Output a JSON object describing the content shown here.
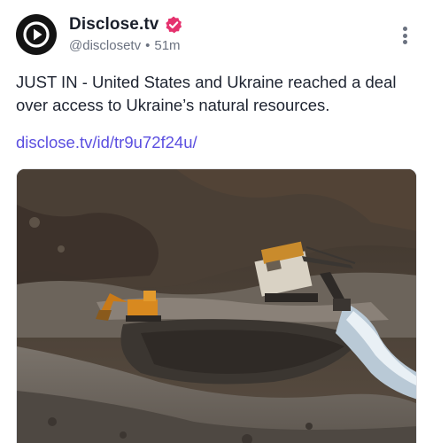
{
  "post": {
    "author_name": "Disclose.tv",
    "handle": "@disclosetv",
    "separator": "•",
    "time_ago": "51m",
    "text": "JUST IN - United States and Ukraine reached a deal over access to Ukraine’s natural resources.",
    "link_text": "disclose.tv/id/tr9u72f24u/"
  },
  "icons": {
    "avatar": "play-logo-icon",
    "verified": "verified-badge-icon",
    "more": "more-vertical-icon"
  },
  "colors": {
    "link": "#5b4fe0",
    "verified_badge": "#e5326e",
    "name": "#1a1f2b",
    "meta": "#6b7280"
  },
  "media": {
    "kind": "photo",
    "subject": "open-pit mine with excavators"
  }
}
